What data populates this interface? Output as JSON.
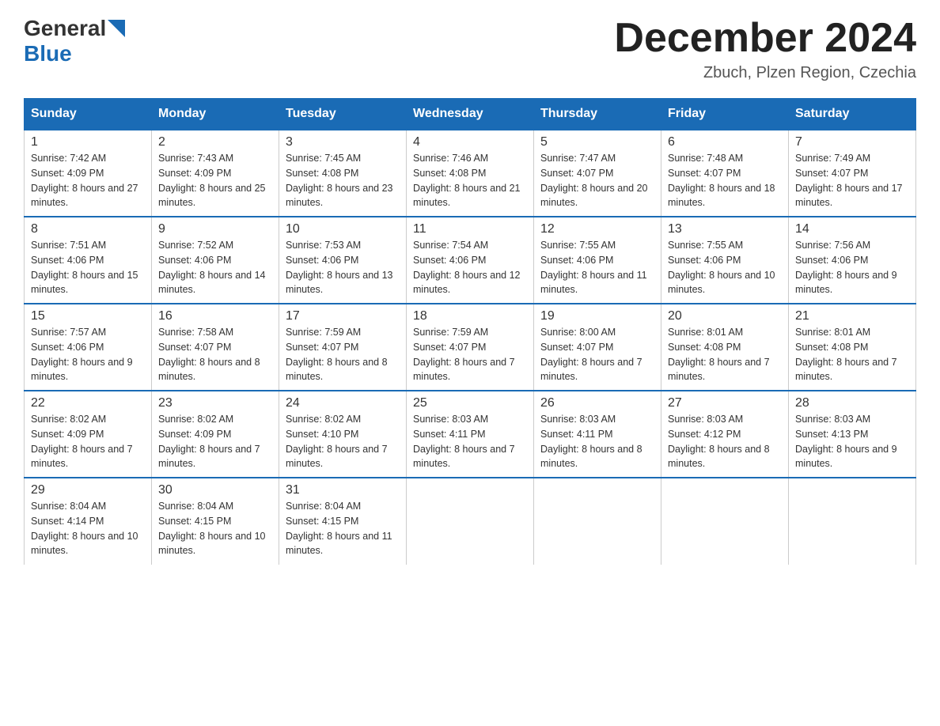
{
  "header": {
    "logo_general": "General",
    "logo_blue": "Blue",
    "month_title": "December 2024",
    "location": "Zbuch, Plzen Region, Czechia"
  },
  "days_of_week": [
    "Sunday",
    "Monday",
    "Tuesday",
    "Wednesday",
    "Thursday",
    "Friday",
    "Saturday"
  ],
  "weeks": [
    [
      {
        "day": "1",
        "sunrise": "7:42 AM",
        "sunset": "4:09 PM",
        "daylight": "8 hours and 27 minutes."
      },
      {
        "day": "2",
        "sunrise": "7:43 AM",
        "sunset": "4:09 PM",
        "daylight": "8 hours and 25 minutes."
      },
      {
        "day": "3",
        "sunrise": "7:45 AM",
        "sunset": "4:08 PM",
        "daylight": "8 hours and 23 minutes."
      },
      {
        "day": "4",
        "sunrise": "7:46 AM",
        "sunset": "4:08 PM",
        "daylight": "8 hours and 21 minutes."
      },
      {
        "day": "5",
        "sunrise": "7:47 AM",
        "sunset": "4:07 PM",
        "daylight": "8 hours and 20 minutes."
      },
      {
        "day": "6",
        "sunrise": "7:48 AM",
        "sunset": "4:07 PM",
        "daylight": "8 hours and 18 minutes."
      },
      {
        "day": "7",
        "sunrise": "7:49 AM",
        "sunset": "4:07 PM",
        "daylight": "8 hours and 17 minutes."
      }
    ],
    [
      {
        "day": "8",
        "sunrise": "7:51 AM",
        "sunset": "4:06 PM",
        "daylight": "8 hours and 15 minutes."
      },
      {
        "day": "9",
        "sunrise": "7:52 AM",
        "sunset": "4:06 PM",
        "daylight": "8 hours and 14 minutes."
      },
      {
        "day": "10",
        "sunrise": "7:53 AM",
        "sunset": "4:06 PM",
        "daylight": "8 hours and 13 minutes."
      },
      {
        "day": "11",
        "sunrise": "7:54 AM",
        "sunset": "4:06 PM",
        "daylight": "8 hours and 12 minutes."
      },
      {
        "day": "12",
        "sunrise": "7:55 AM",
        "sunset": "4:06 PM",
        "daylight": "8 hours and 11 minutes."
      },
      {
        "day": "13",
        "sunrise": "7:55 AM",
        "sunset": "4:06 PM",
        "daylight": "8 hours and 10 minutes."
      },
      {
        "day": "14",
        "sunrise": "7:56 AM",
        "sunset": "4:06 PM",
        "daylight": "8 hours and 9 minutes."
      }
    ],
    [
      {
        "day": "15",
        "sunrise": "7:57 AM",
        "sunset": "4:06 PM",
        "daylight": "8 hours and 9 minutes."
      },
      {
        "day": "16",
        "sunrise": "7:58 AM",
        "sunset": "4:07 PM",
        "daylight": "8 hours and 8 minutes."
      },
      {
        "day": "17",
        "sunrise": "7:59 AM",
        "sunset": "4:07 PM",
        "daylight": "8 hours and 8 minutes."
      },
      {
        "day": "18",
        "sunrise": "7:59 AM",
        "sunset": "4:07 PM",
        "daylight": "8 hours and 7 minutes."
      },
      {
        "day": "19",
        "sunrise": "8:00 AM",
        "sunset": "4:07 PM",
        "daylight": "8 hours and 7 minutes."
      },
      {
        "day": "20",
        "sunrise": "8:01 AM",
        "sunset": "4:08 PM",
        "daylight": "8 hours and 7 minutes."
      },
      {
        "day": "21",
        "sunrise": "8:01 AM",
        "sunset": "4:08 PM",
        "daylight": "8 hours and 7 minutes."
      }
    ],
    [
      {
        "day": "22",
        "sunrise": "8:02 AM",
        "sunset": "4:09 PM",
        "daylight": "8 hours and 7 minutes."
      },
      {
        "day": "23",
        "sunrise": "8:02 AM",
        "sunset": "4:09 PM",
        "daylight": "8 hours and 7 minutes."
      },
      {
        "day": "24",
        "sunrise": "8:02 AM",
        "sunset": "4:10 PM",
        "daylight": "8 hours and 7 minutes."
      },
      {
        "day": "25",
        "sunrise": "8:03 AM",
        "sunset": "4:11 PM",
        "daylight": "8 hours and 7 minutes."
      },
      {
        "day": "26",
        "sunrise": "8:03 AM",
        "sunset": "4:11 PM",
        "daylight": "8 hours and 8 minutes."
      },
      {
        "day": "27",
        "sunrise": "8:03 AM",
        "sunset": "4:12 PM",
        "daylight": "8 hours and 8 minutes."
      },
      {
        "day": "28",
        "sunrise": "8:03 AM",
        "sunset": "4:13 PM",
        "daylight": "8 hours and 9 minutes."
      }
    ],
    [
      {
        "day": "29",
        "sunrise": "8:04 AM",
        "sunset": "4:14 PM",
        "daylight": "8 hours and 10 minutes."
      },
      {
        "day": "30",
        "sunrise": "8:04 AM",
        "sunset": "4:15 PM",
        "daylight": "8 hours and 10 minutes."
      },
      {
        "day": "31",
        "sunrise": "8:04 AM",
        "sunset": "4:15 PM",
        "daylight": "8 hours and 11 minutes."
      },
      {
        "day": "",
        "sunrise": "",
        "sunset": "",
        "daylight": ""
      },
      {
        "day": "",
        "sunrise": "",
        "sunset": "",
        "daylight": ""
      },
      {
        "day": "",
        "sunrise": "",
        "sunset": "",
        "daylight": ""
      },
      {
        "day": "",
        "sunrise": "",
        "sunset": "",
        "daylight": ""
      }
    ]
  ]
}
